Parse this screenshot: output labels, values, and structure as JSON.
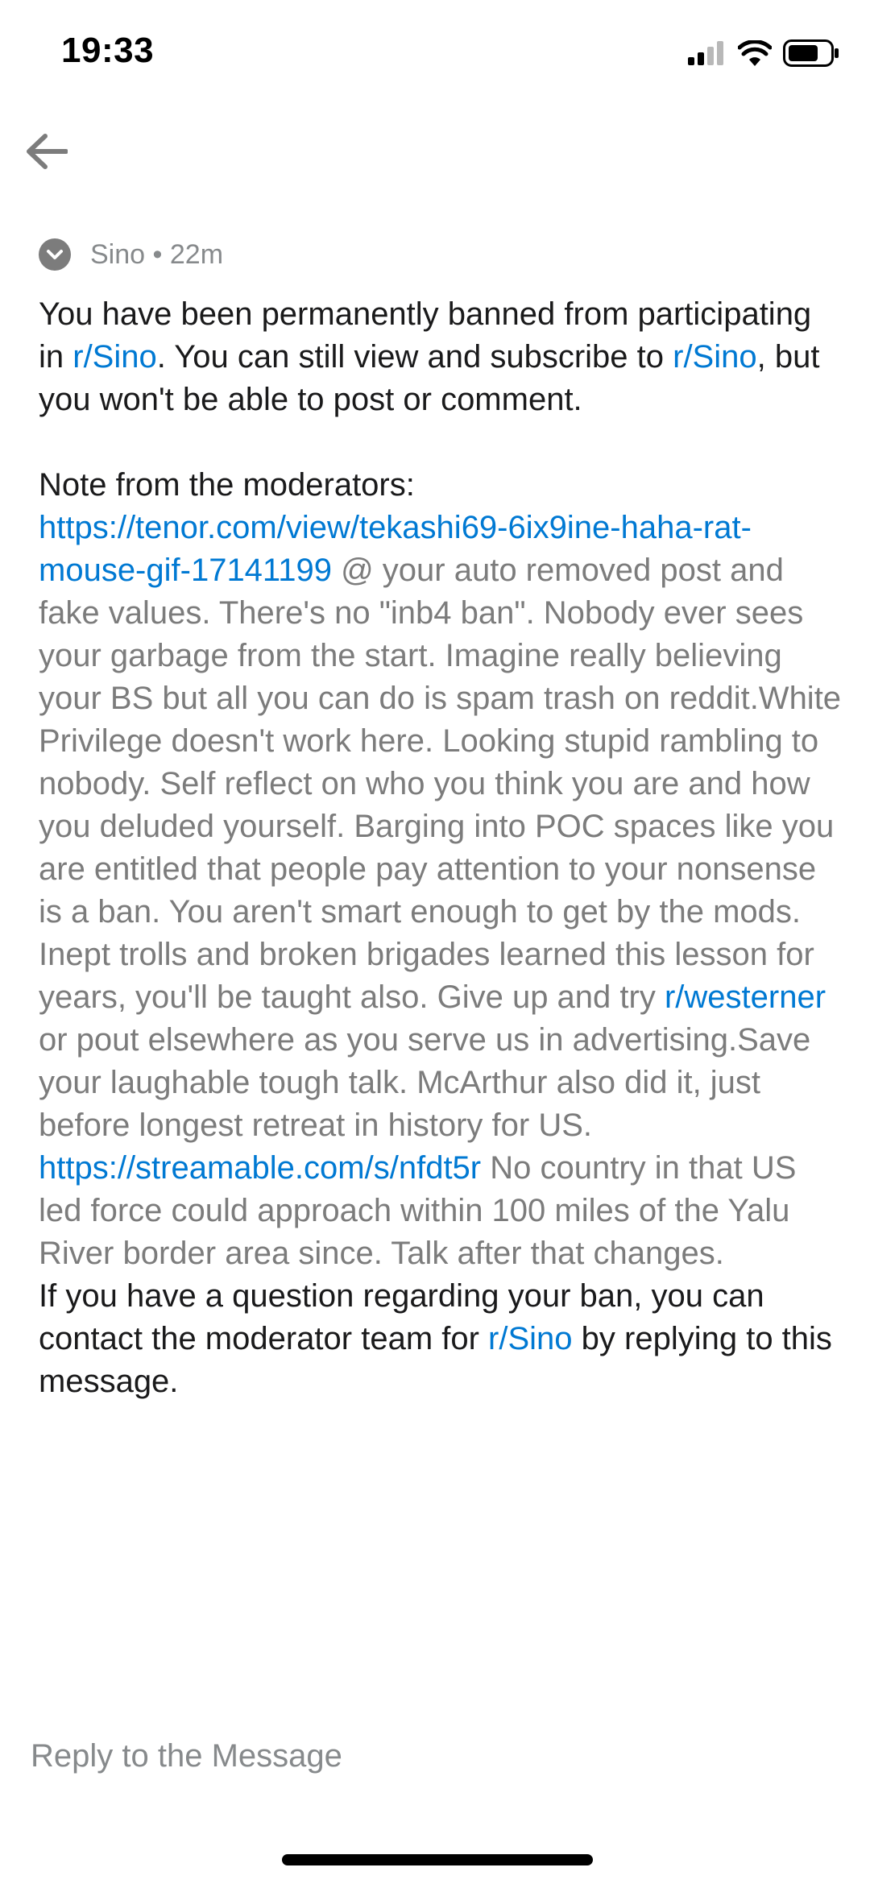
{
  "status_bar": {
    "time": "19:33",
    "icons": [
      "cellular-signal-icon",
      "wifi-icon",
      "battery-icon"
    ]
  },
  "header": {
    "back_icon": "back-arrow-icon"
  },
  "message": {
    "sender": "Sino",
    "separator": "•",
    "age": "22m",
    "intro": {
      "t1": "You have been permanently banned from participating in ",
      "link1": "r/Sino",
      "t2": ". You can still view and subscribe to ",
      "link2": "r/Sino",
      "t3": ", but you won't be able to post or comment."
    },
    "note_label": "Note from the moderators:",
    "note": {
      "link1": "https://tenor.com/view/tekashi69-6ix9ine-haha-rat-mouse-gif-17141199",
      "t1": " @ your auto removed post and fake values. There's no \"inb4 ban\". Nobody ever sees your garbage from the start. Imagine really believing your BS but all you can do is spam trash on reddit.White Privilege doesn't work here. Looking stupid rambling to nobody. Self reflect on who you think you are and how you deluded yourself. Barging into POC spaces like you are entitled that people pay attention to your nonsense is a ban. You aren't smart enough to get by the mods. Inept trolls and broken brigades learned this lesson for years, you'll be taught also. Give up and try ",
      "link2": "r/westerner",
      "t2": " or pout elsewhere as you serve us in advertising.Save your laughable tough talk. McArthur also did it, just before longest retreat in history for US. ",
      "link3": "https://streamable.com/s/nfdt5r",
      "t3": " No country in that US led force could approach within 100 miles of the Yalu River border area since. Talk after that changes."
    },
    "outro": {
      "t1": "If you have a question regarding your ban, you can contact the moderator team for ",
      "link": "r/Sino",
      "t2": " by replying to this message."
    }
  },
  "reply": {
    "placeholder": "Reply to the Message"
  },
  "colors": {
    "link": "#0079d3",
    "body_text": "#1a1a1b",
    "quote_text": "#7c7c7c",
    "meta_text": "#878a8c"
  }
}
